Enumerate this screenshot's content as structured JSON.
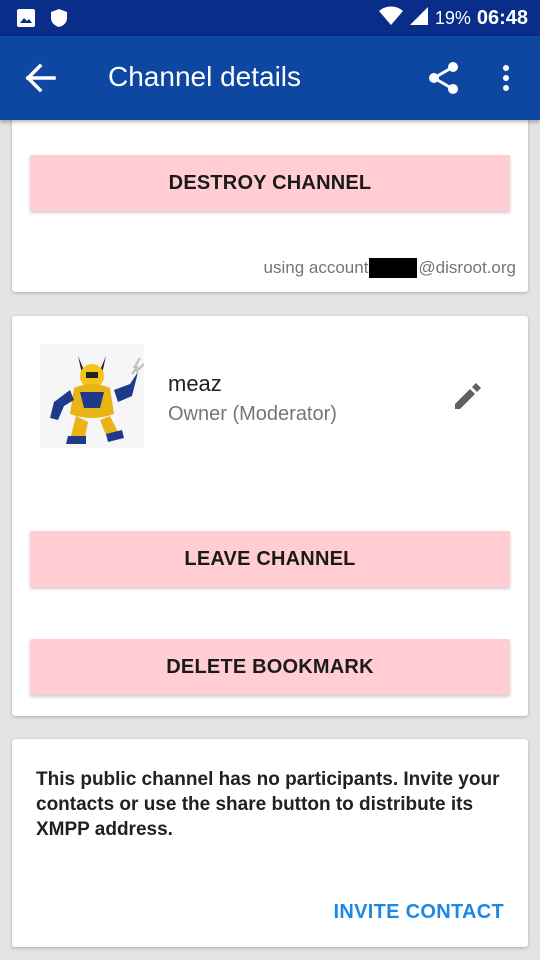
{
  "status_bar": {
    "battery": "19%",
    "time": "06:48",
    "icons": [
      "image-icon",
      "shield-icon",
      "wifi-icon",
      "signal-icon",
      "battery-icon"
    ]
  },
  "app_bar": {
    "title": "Channel details",
    "icons": [
      "back-arrow-icon",
      "share-icon",
      "more-vert-icon"
    ]
  },
  "owner_actions": {
    "destroy_label": "DESTROY CHANNEL",
    "account_prefix": "using account",
    "account_suffix": "@disroot.org"
  },
  "self": {
    "nick": "meaz",
    "role": "Owner (Moderator)",
    "leave_label": "LEAVE CHANNEL",
    "delete_bookmark_label": "DELETE BOOKMARK"
  },
  "participants": {
    "empty_message": "This public channel has no participants. Invite your contacts or use the share button to distribute its XMPP address.",
    "invite_label": "INVITE CONTACT"
  },
  "colors": {
    "status_bar": "#0b2d8a",
    "app_bar": "#0d47a1",
    "button_bg": "#ffcdd2",
    "accent": "#1e88e5"
  }
}
